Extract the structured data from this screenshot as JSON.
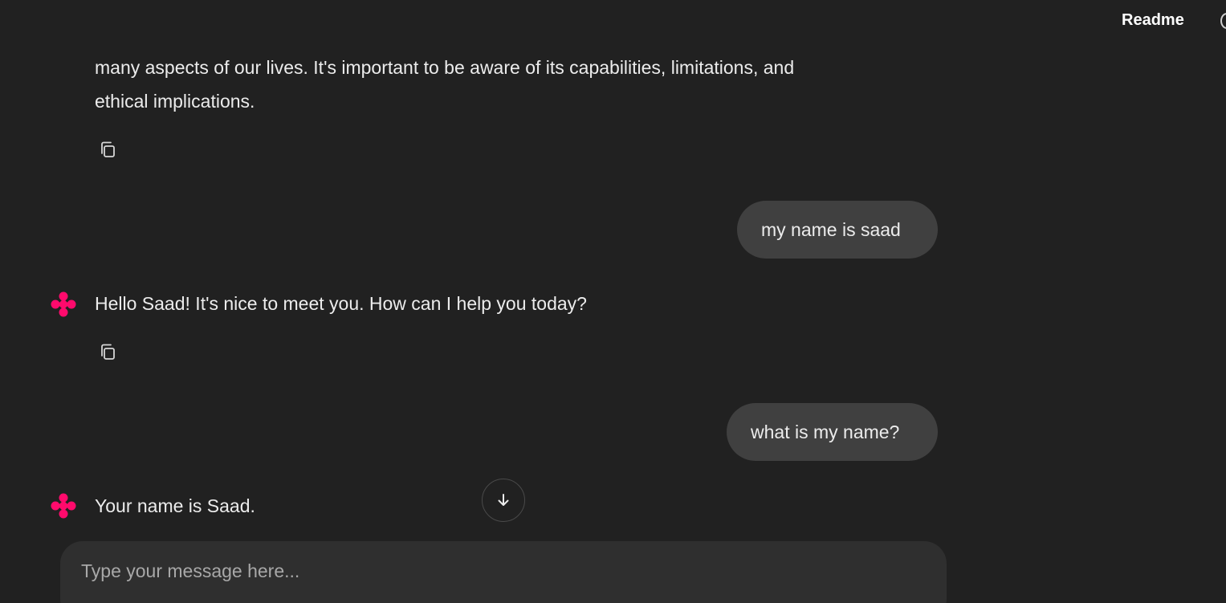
{
  "header": {
    "readme_label": "Readme"
  },
  "messages": {
    "assistant_partial": {
      "line1": "many aspects of our lives. It's important to be aware of its capabilities, limitations, and",
      "line2": "ethical implications."
    },
    "user_1": "my name is saad",
    "assistant_1": "Hello Saad! It's nice to meet you. How can I help you today?",
    "user_2": "what is my name?",
    "assistant_2": "Your name is Saad."
  },
  "composer": {
    "placeholder": "Type your message here..."
  },
  "icons": {
    "copy": "copy-icon",
    "avatar": "assistant-logo-icon",
    "scroll": "arrow-down-icon"
  },
  "colors": {
    "background": "#212121",
    "user_bubble": "#404040",
    "composer": "#2f2f2f",
    "brand_accent": "#ff0a6c"
  }
}
